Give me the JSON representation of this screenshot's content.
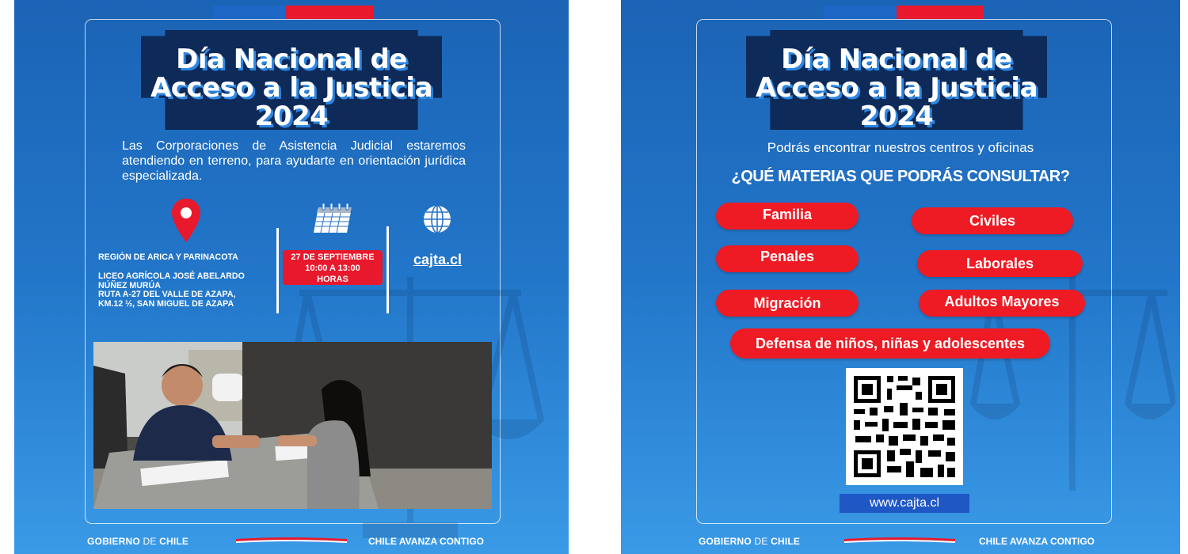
{
  "left": {
    "title_lines": [
      "Día Nacional de",
      "Acceso a la Justicia",
      "2024"
    ],
    "intro": "Las Corporaciones de Asistencia Judicial estaremos atendiendo en terreno, para ayudarte en orientación jurídica especializada.",
    "region": "REGIÓN DE ARICA Y PARINACOTA",
    "address_lines": [
      "LICEO AGRÍCOLA JOSÉ ABELARDO",
      "NÚÑEZ MURÚA",
      "RUTA A-27 DEL VALLE DE AZAPA,",
      "KM.12 ½, SAN MIGUEL DE AZAPA"
    ],
    "date_lines": [
      "27 DE SEPTIEMBRE",
      "10:00 A 13:00",
      "HORAS"
    ],
    "website": "cajta.cl",
    "icons": {
      "location": "location-pin-icon",
      "calendar": "calendar-icon",
      "globe": "globe-icon"
    }
  },
  "right": {
    "title_lines": [
      "Día Nacional de",
      "Acceso a la Justicia",
      "2024"
    ],
    "subtitle": "Podrás encontrar nuestros centros y oficinas",
    "question": "¿QUÉ MATERIAS QUE PODRÁS CONSULTAR?",
    "topics": [
      "Familia",
      "Civiles",
      "Penales",
      "Laborales",
      "Migración",
      "Adultos Mayores",
      "Defensa de niños, niñas y adolescentes"
    ],
    "url": "www.cajta.cl"
  },
  "footer": {
    "gov_bold": "GOBIERNO",
    "gov_light": "DE",
    "gov_country": "CHILE",
    "slogan": "CHILE AVANZA CONTIGO"
  },
  "colors": {
    "background_top": "#1b63b5",
    "background_bottom": "#3a9ae6",
    "title_panel": "#0d2a58",
    "accent_red": "#ee1b24",
    "flag_blue": "#1e67c6",
    "url_bar": "#1f57c4"
  }
}
